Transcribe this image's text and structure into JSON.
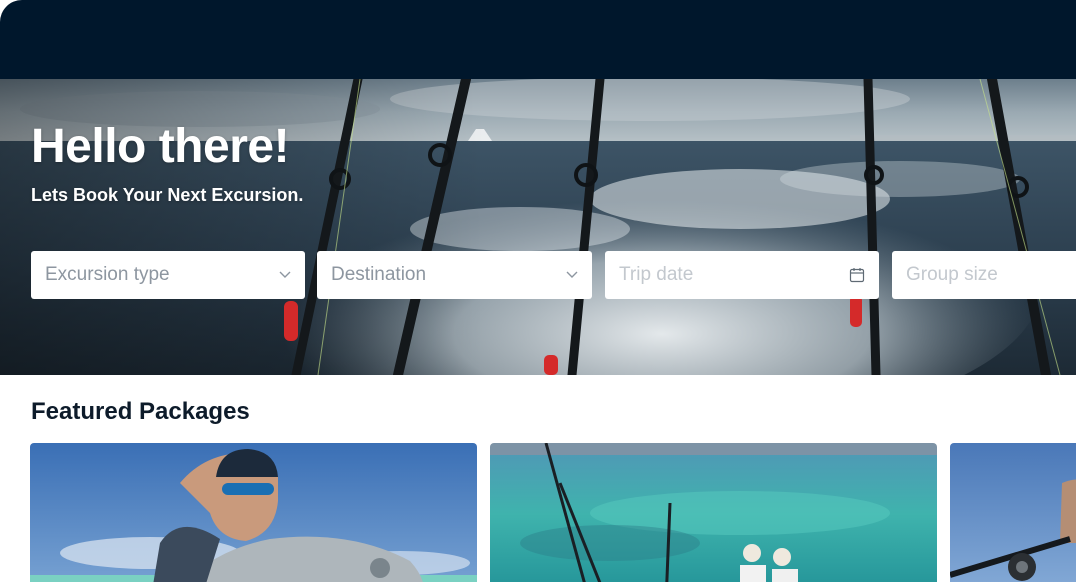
{
  "hero": {
    "title": "Hello there!",
    "subtitle": "Lets Book Your Next Excursion."
  },
  "search": {
    "excursion_type": {
      "placeholder": "Excursion type",
      "icon": "chevron-down-icon"
    },
    "destination": {
      "placeholder": "Destination",
      "icon": "chevron-down-icon"
    },
    "trip_date": {
      "placeholder": "Trip date",
      "icon": "calendar-icon"
    },
    "group_size": {
      "placeholder": "Group size"
    }
  },
  "featured": {
    "title": "Featured Packages",
    "cards": [
      {
        "image": "angler-with-giant-trevally"
      },
      {
        "image": "anglers-on-boat-over-turquoise-reef"
      },
      {
        "image": "angler-with-fishing-reel"
      }
    ]
  },
  "colors": {
    "header_navy": "#00172c",
    "title_text": "#0d1b2a",
    "placeholder_text": "#8d96a0"
  }
}
